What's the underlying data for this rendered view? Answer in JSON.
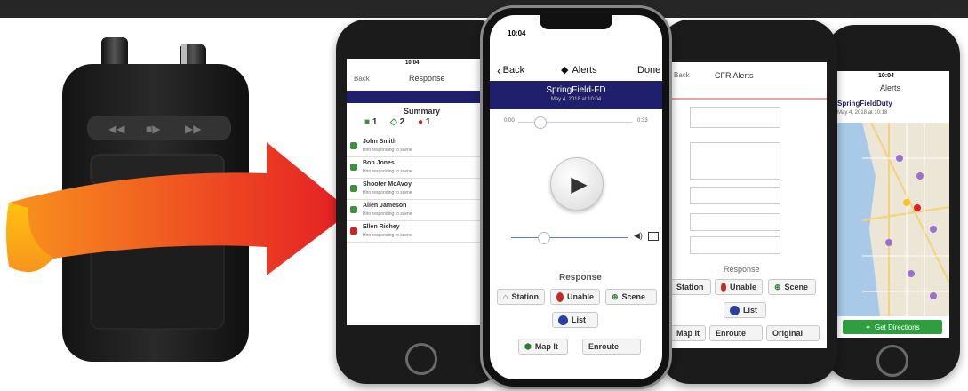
{
  "phone_center": {
    "status_time": "10:04",
    "nav_back": "Back",
    "nav_title": "Alerts",
    "nav_done": "Done",
    "banner_title": "SpringField-FD",
    "banner_date": "May 4, 2018 at 10:04",
    "time_start": "0:00",
    "time_end": "0:33",
    "response_heading": "Response",
    "btn_station": "Station",
    "btn_unable": "Unable",
    "btn_scene": "Scene",
    "btn_list": "List",
    "btn_map": "Map It",
    "btn_enroute": "Enroute"
  },
  "phone_left": {
    "status_time": "10:04",
    "nav_back": "Back",
    "nav_title": "Response",
    "summary": "Summary",
    "count_green": "1",
    "count_blue": "2",
    "count_red": "1",
    "people": [
      {
        "name": "John Smith",
        "sub": "Hiro responding to scene",
        "color": "#3f8f3f"
      },
      {
        "name": "Bob Jones",
        "sub": "Hiro responding to scene",
        "color": "#3f8f3f"
      },
      {
        "name": "Shooter McAvoy",
        "sub": "Hiro responding to scene",
        "color": "#3f8f3f"
      },
      {
        "name": "Allen Jameson",
        "sub": "Hiro responding to scene",
        "color": "#3f8f3f"
      },
      {
        "name": "Ellen Richey",
        "sub": "Hiro responding to scene",
        "color": "#c62828"
      }
    ]
  },
  "phone_third": {
    "nav_back": "Back",
    "nav_title": "CFR Alerts",
    "response_heading": "Response",
    "btn_station": "Station",
    "btn_unable": "Unable",
    "btn_scene": "Scene",
    "btn_list": "List",
    "btn_map": "Map It",
    "btn_enroute": "Enroute",
    "btn_original": "Original"
  },
  "phone_right": {
    "status_time": "10:04",
    "nav_title": "Alerts",
    "header_name": "SpringFieldDuty",
    "header_date": "May 4, 2018 at 10:18",
    "directions_button": "Get Directions"
  },
  "colors": {
    "banner": "#1f1f6b",
    "arrow_red": "#e31e24",
    "arrow_orange": "#f7941d",
    "directions_green": "#2e9e3e"
  },
  "icons": {
    "back": "chevron-left-icon",
    "speaker": "speaker-icon",
    "play": "play-icon"
  }
}
